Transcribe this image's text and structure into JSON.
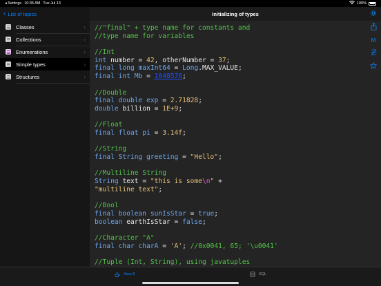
{
  "status_bar": {
    "back_app": "◂ Settings",
    "time": "10:35 AM",
    "date": "Tue Jul 13",
    "battery": "100%"
  },
  "sidebar": {
    "back_label": "List of topics",
    "items": [
      {
        "label": "Classes",
        "icon": "doc-icon"
      },
      {
        "label": "Collections",
        "icon": "doc-icon"
      },
      {
        "label": "Enumerations",
        "icon": "doc-icon"
      },
      {
        "label": "Simple types",
        "icon": "doc-icon"
      },
      {
        "label": "Structures",
        "icon": "doc-icon"
      }
    ],
    "selected_index": 3
  },
  "main": {
    "title": "Initializing of types",
    "code_lines": [
      [
        {
          "t": "//\"final\" + type name for constants and",
          "c": "c"
        }
      ],
      [
        {
          "t": "//type name for variables",
          "c": "c"
        }
      ],
      [],
      [
        {
          "t": "//Int",
          "c": "c"
        }
      ],
      [
        {
          "t": "int ",
          "c": "k"
        },
        {
          "t": "number = ",
          "c": "p"
        },
        {
          "t": "42",
          "c": "n"
        },
        {
          "t": ", otherNumber = ",
          "c": "p"
        },
        {
          "t": "37",
          "c": "n"
        },
        {
          "t": ";",
          "c": "p"
        }
      ],
      [
        {
          "t": "final long ",
          "c": "k"
        },
        {
          "t": "maxInt64",
          "c": "k"
        },
        {
          "t": " = ",
          "c": "p"
        },
        {
          "t": "Long",
          "c": "k"
        },
        {
          "t": ".MAX_VALUE;",
          "c": "p"
        }
      ],
      [
        {
          "t": "final int ",
          "c": "k"
        },
        {
          "t": "Mb",
          "c": "k"
        },
        {
          "t": " = ",
          "c": "p"
        },
        {
          "t": "1048576",
          "c": "link"
        },
        {
          "t": ";",
          "c": "p"
        }
      ],
      [],
      [
        {
          "t": "//Double",
          "c": "c"
        }
      ],
      [
        {
          "t": "final double ",
          "c": "k"
        },
        {
          "t": "exp",
          "c": "k"
        },
        {
          "t": " = ",
          "c": "p"
        },
        {
          "t": "2.71828",
          "c": "n"
        },
        {
          "t": ";",
          "c": "p"
        }
      ],
      [
        {
          "t": "double ",
          "c": "k"
        },
        {
          "t": "billion = ",
          "c": "p"
        },
        {
          "t": "1E+9",
          "c": "n"
        },
        {
          "t": ";",
          "c": "p"
        }
      ],
      [],
      [
        {
          "t": "//Float",
          "c": "c"
        }
      ],
      [
        {
          "t": "final float ",
          "c": "k"
        },
        {
          "t": "pi",
          "c": "k"
        },
        {
          "t": " = ",
          "c": "p"
        },
        {
          "t": "3.14f",
          "c": "n"
        },
        {
          "t": ";",
          "c": "p"
        }
      ],
      [],
      [
        {
          "t": "//String",
          "c": "c"
        }
      ],
      [
        {
          "t": "final String ",
          "c": "k"
        },
        {
          "t": "greeting",
          "c": "k"
        },
        {
          "t": " = ",
          "c": "p"
        },
        {
          "t": "\"Hello\"",
          "c": "s"
        },
        {
          "t": ";",
          "c": "p"
        }
      ],
      [],
      [
        {
          "t": "//Multiline String",
          "c": "c"
        }
      ],
      [
        {
          "t": "String ",
          "c": "k"
        },
        {
          "t": "text = ",
          "c": "p"
        },
        {
          "t": "\"this is some",
          "c": "s"
        },
        {
          "t": "\\n",
          "c": "esc"
        },
        {
          "t": "\"",
          "c": "s"
        },
        {
          "t": " +",
          "c": "p"
        }
      ],
      [
        {
          "t": "\"multiline text\"",
          "c": "s"
        },
        {
          "t": ";",
          "c": "p"
        }
      ],
      [],
      [
        {
          "t": "//Bool",
          "c": "c"
        }
      ],
      [
        {
          "t": "final boolean ",
          "c": "k"
        },
        {
          "t": "sunIsStar",
          "c": "k"
        },
        {
          "t": " = ",
          "c": "p"
        },
        {
          "t": "true",
          "c": "k"
        },
        {
          "t": ";",
          "c": "p"
        }
      ],
      [
        {
          "t": "boolean ",
          "c": "k"
        },
        {
          "t": "earthIsStar = ",
          "c": "p"
        },
        {
          "t": "false",
          "c": "k"
        },
        {
          "t": ";",
          "c": "p"
        }
      ],
      [],
      [
        {
          "t": "//Character \"A\"",
          "c": "c"
        }
      ],
      [
        {
          "t": "final char ",
          "c": "k"
        },
        {
          "t": "charA",
          "c": "k"
        },
        {
          "t": " = ",
          "c": "p"
        },
        {
          "t": "'A'",
          "c": "s"
        },
        {
          "t": "; ",
          "c": "p"
        },
        {
          "t": "//0x0041, 65; '\\u0041'",
          "c": "c"
        }
      ],
      [],
      [
        {
          "t": "//Tuple (Int, String), using javatuples",
          "c": "c"
        }
      ]
    ]
  },
  "tabs": [
    {
      "label": "Java 8",
      "active": true
    },
    {
      "label": "SQL",
      "active": false
    }
  ],
  "right_rail": [
    "settings-icon",
    "share-icon",
    "markdown-icon",
    "strikethrough-icon",
    "star-icon"
  ],
  "colors": {
    "accent": "#0a84ff",
    "comment": "#53c24a",
    "keyword": "#6ea8f0",
    "string": "#e8c178",
    "link": "#1f4cff"
  }
}
